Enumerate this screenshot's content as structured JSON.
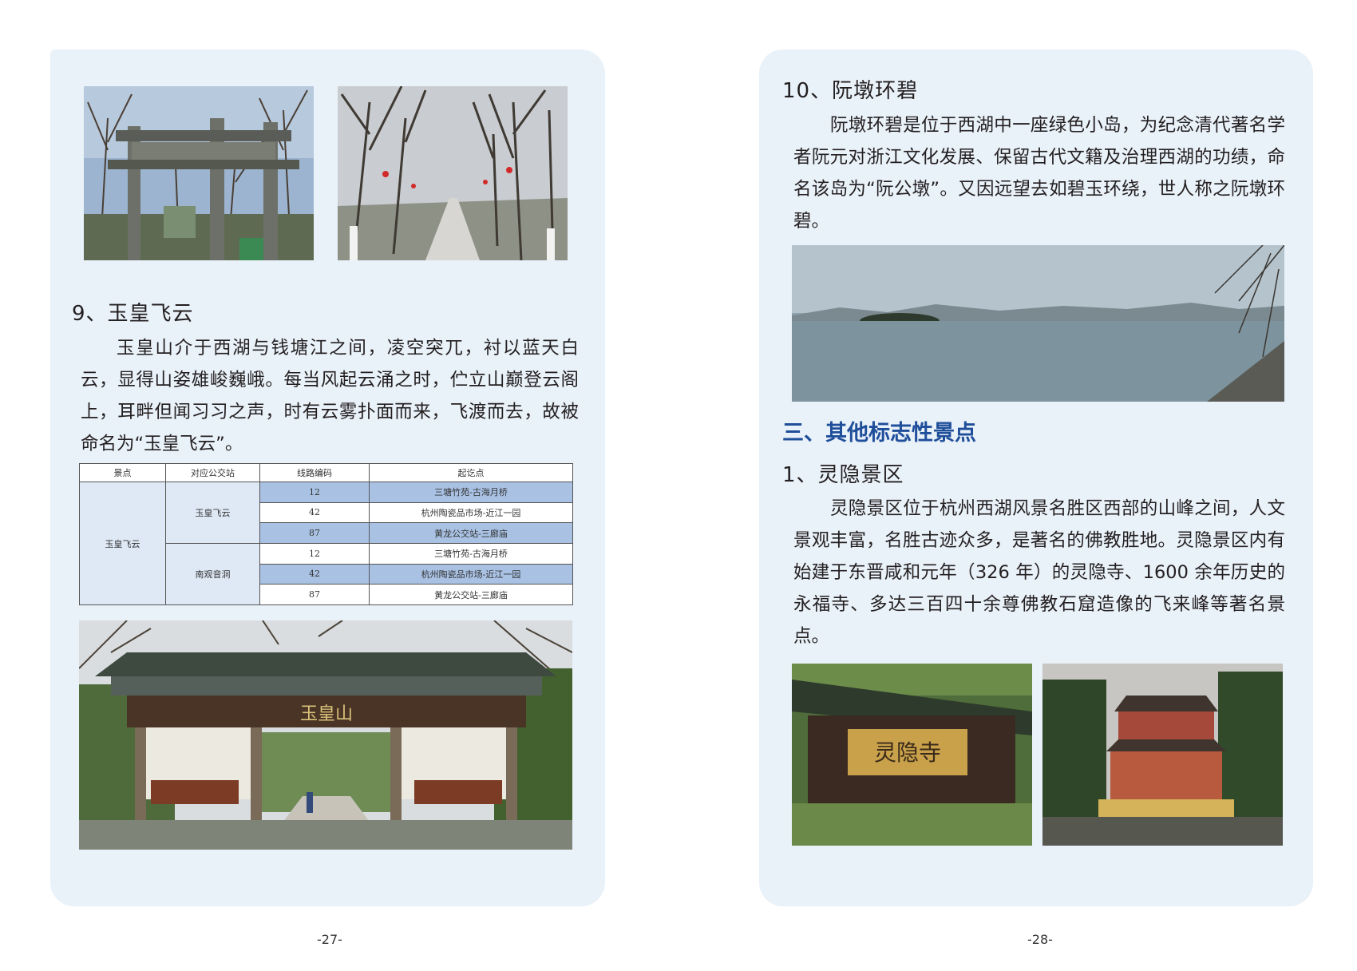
{
  "left_page": {
    "heading": "9、玉皇飞云",
    "paragraph": "玉皇山介于西湖与钱塘江之间，凌空突兀，衬以蓝天白云，显得山姿雄峻巍峨。每当风起云涌之时，伫立山巅登云阁上，耳畔但闻习习之声，时有云雾扑面而来，飞渡而去，故被命名为“玉皇飞云”。",
    "gate_sign": "玉皇山",
    "table": {
      "headers": [
        "景点",
        "对应公交站",
        "线路编码",
        "起讫点"
      ],
      "scenic": "玉皇飞云",
      "stations": [
        "玉皇飞云",
        "南观音洞"
      ],
      "rows": [
        {
          "code": "12",
          "route": "三塘竹苑-古海月桥"
        },
        {
          "code": "42",
          "route": "杭州陶瓷品市场-近江一园"
        },
        {
          "code": "87",
          "route": "黄龙公交站-三廊庙"
        },
        {
          "code": "12",
          "route": "三塘竹苑-古海月桥"
        },
        {
          "code": "42",
          "route": "杭州陶瓷品市场-近江一园"
        },
        {
          "code": "87",
          "route": "黄龙公交站-三廊庙"
        }
      ]
    },
    "page_number": "-27-"
  },
  "right_page": {
    "heading": "10、阮墩环碧",
    "paragraph": "阮墩环碧是位于西湖中一座绿色小岛，为纪念清代著名学者阮元对浙江文化发展、保留古代文籍及治理西湖的功绩，命名该岛为“阮公墩”。又因远望去如碧玉环绕，世人称之阮墩环碧。",
    "section_heading": "三、其他标志性景点",
    "sub_heading": "1、灵隐景区",
    "paragraph2": "灵隐景区位于杭州西湖风景名胜区西部的山峰之间，人文景观丰富，名胜古迹众多，是著名的佛教胜地。灵隐景区内有始建于东晋咸和元年（326 年）的灵隐寺、1600 余年历史的永福寺、多达三百四十余尊佛教石窟造像的飞来峰等著名景点。",
    "temple_sign": "灵隐寺",
    "page_number": "-28-"
  },
  "colors": {
    "panel": "#e9f1f9",
    "section_heading": "#1f4e9a",
    "table_shade": "#a9c2e4"
  }
}
